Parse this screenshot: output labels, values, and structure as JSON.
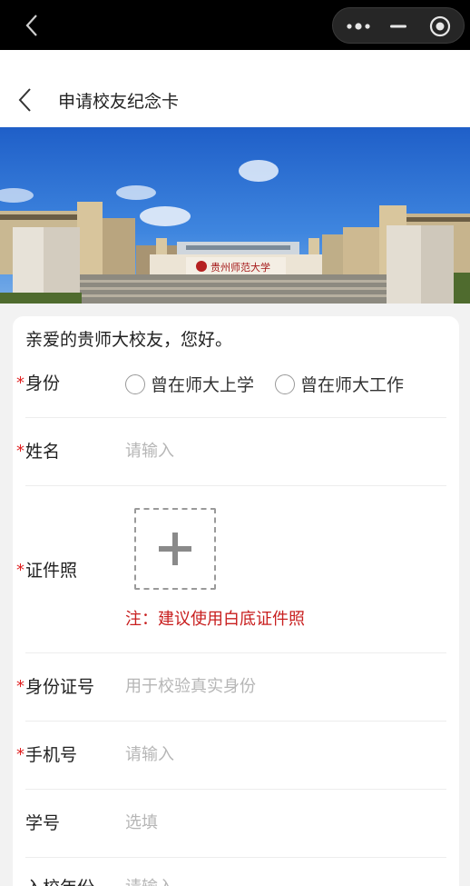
{
  "nav": {
    "title": "申请校友纪念卡"
  },
  "banner": {
    "sign_text": "贵州师范大学"
  },
  "form": {
    "greeting": "亲爱的贵师大校友，您好。",
    "required_mark": "*",
    "identity": {
      "label": "身份",
      "options": [
        "曾在师大上学",
        "曾在师大工作"
      ]
    },
    "name": {
      "label": "姓名",
      "placeholder": "请输入"
    },
    "photo": {
      "label": "证件照",
      "note": "注：建议使用白底证件照"
    },
    "id_number": {
      "label": "身份证号",
      "placeholder": "用于校验真实身份"
    },
    "phone": {
      "label": "手机号",
      "placeholder": "请输入"
    },
    "student_no": {
      "label": "学号",
      "placeholder": "选填"
    },
    "enroll_year": {
      "label": "入校年份",
      "placeholder": "请输入"
    }
  },
  "colors": {
    "required": "#e02020",
    "note": "#c81e1e",
    "placeholder": "#b6b6b6",
    "sky": "#2f74d6"
  },
  "icons": [
    "back-icon",
    "more-icon",
    "minimize-icon",
    "close-icon",
    "plus-icon"
  ]
}
